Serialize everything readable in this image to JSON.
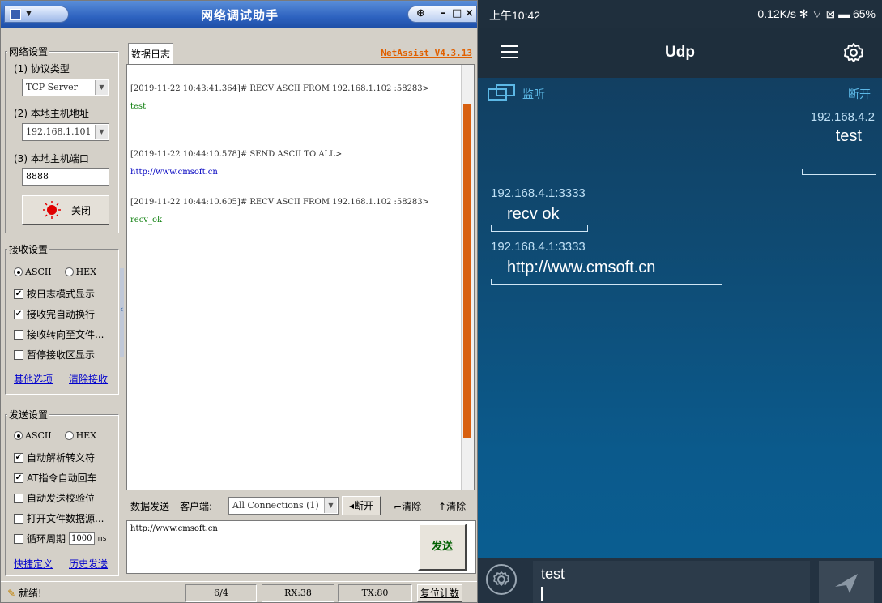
{
  "window": {
    "title": "网络调试助手",
    "brand": "NetAssist V4.3.13"
  },
  "net_settings": {
    "group": "网络设置",
    "protocol_label": "(1) 协议类型",
    "protocol_value": "TCP Server",
    "host_label": "(2) 本地主机地址",
    "host_value": "192.168.1.101",
    "port_label": "(3) 本地主机端口",
    "port_value": "8888",
    "close_button": "关闭"
  },
  "recv_settings": {
    "group": "接收设置",
    "ascii": "ASCII",
    "hex": "HEX",
    "options": [
      "按日志模式显示",
      "接收完自动换行",
      "接收转向至文件...",
      "暂停接收区显示"
    ],
    "options_checked": [
      true,
      true,
      false,
      false
    ],
    "more_link": "其他选项",
    "clear_link": "清除接收"
  },
  "send_settings": {
    "group": "发送设置",
    "ascii": "ASCII",
    "hex": "HEX",
    "options": [
      "自动解析转义符",
      "AT指令自动回车",
      "自动发送校验位",
      "打开文件数据源..."
    ],
    "options_checked": [
      true,
      true,
      false,
      false
    ],
    "loop_label": "循环周期",
    "loop_value": "1000",
    "loop_unit": "ms",
    "shortcut_link": "快捷定义",
    "history_link": "历史发送"
  },
  "log": {
    "tab": "数据日志",
    "lines": [
      "[2019-11-22 10:43:41.364]# RECV ASCII FROM 192.168.1.102 :58283>",
      "test",
      "[2019-11-22 10:44:10.578]# SEND ASCII TO ALL>",
      "http://www.cmsoft.cn",
      "[2019-11-22 10:44:10.605]# RECV ASCII FROM 192.168.1.102 :58283>",
      "recv_ok"
    ]
  },
  "send_bar": {
    "tab": "数据发送",
    "client_label": "客户端:",
    "client_value": "All Connections (1)",
    "disconnect": "断开",
    "clear1": "清除",
    "clear2": "清除",
    "text": "http://www.cmsoft.cn",
    "send_button": "发送"
  },
  "statusbar": {
    "ready": "就绪!",
    "count": "6/4",
    "rx": "RX:38",
    "tx": "TX:80",
    "reset": "复位计数"
  },
  "phone": {
    "time": "上午10:42",
    "status_right": "0.12K/s ✻ ⌔ ⊠ ▬ 65%",
    "title": "Udp",
    "listen": "监听",
    "disconnect": "断开",
    "messages": [
      {
        "src": "192.168.4.2",
        "body": "test"
      },
      {
        "src": "192.168.4.1:3333",
        "body": "recv ok"
      },
      {
        "src": "192.168.4.1:3333",
        "body": "http://www.cmsoft.cn"
      }
    ],
    "input_value": "test"
  },
  "colors": {
    "brand_orange": "#e06000",
    "log_green": "#108010",
    "phone_accent": "#5cb8e6"
  }
}
